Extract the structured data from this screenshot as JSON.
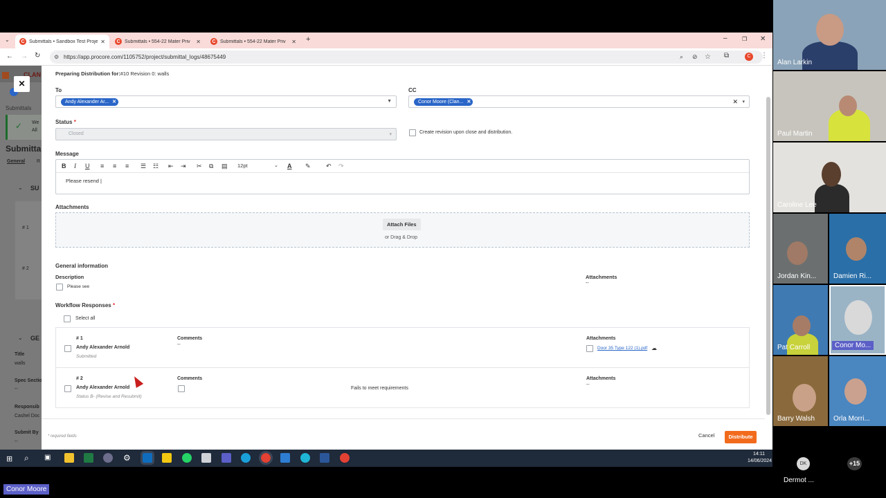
{
  "browser": {
    "tabs": [
      {
        "title": "Submittals • Sandbox Test Proje",
        "active": true
      },
      {
        "title": "Submittals • 554-22 Mater Priv",
        "active": false
      },
      {
        "title": "Submittals • 554-22 Mater Priv",
        "active": false
      }
    ],
    "url": "https://app.procore.com/1105752/project/submittal_logs/48675449",
    "profile_initial": "C"
  },
  "background_page": {
    "logo_partial": "CLAN",
    "breadcrumb": "Submittals",
    "page_title": "Submitta",
    "tabs": [
      "General",
      "R"
    ],
    "banner_line1": "We",
    "banner_line2": "All",
    "section1": "SU",
    "row1": "# 1",
    "row2": "# 2",
    "section2": "GE",
    "title_label": "Title",
    "title_value": "walls",
    "spec_label": "Spec Sectio",
    "spec_value": "--",
    "responsible_label": "Responsib",
    "responsible_value": "Cashel Doc",
    "submit_by_label": "Submit By",
    "submit_by_value": "--"
  },
  "modal": {
    "close_glyph": "✕",
    "heading_label": "Preparing Distribution for:",
    "heading_value": "#10 Revision 0: walls",
    "to_label": "To",
    "to_chip": "Andy Alexander Ar...",
    "cc_label": "CC",
    "cc_chip": "Conor Moore (Clan...",
    "status_label": "Status",
    "required_mark": "*",
    "status_value": "Closed",
    "create_revision_label": "Create revision upon close and distribution.",
    "message_label": "Message",
    "font_size": "12pt",
    "message_text": "Please resend",
    "attachments_label": "Attachments",
    "attach_files_button": "Attach Files",
    "drag_drop": "or Drag & Drop",
    "general_info_title": "General information",
    "description_label": "Description",
    "description_value": "Please see",
    "attachments_right_label": "Attachments",
    "attachments_right_value": "--",
    "workflow_title": "Workflow Responses",
    "select_all": "Select all",
    "responses": [
      {
        "number": "# 1",
        "name": "Andy Alexander Arnold",
        "status": "Submitted",
        "comments_label": "Comments",
        "comments_value": "--",
        "attachments_label": "Attachments",
        "attachment_file": "Door 35 Type 122 (1).pdf"
      },
      {
        "number": "# 2",
        "name": "Andy Alexander Arnold",
        "status": "Status B- (Revise and Resubmit)",
        "comments_label": "Comments",
        "comments_value": "Fails to meet requirements",
        "attachments_label": "Attachments",
        "attachments_value": "--"
      }
    ],
    "required_fields_note": "* required fields",
    "cancel_button": "Cancel",
    "distribute_button": "Distribute"
  },
  "taskbar": {
    "time": "14:11",
    "date": "14/06/2024"
  },
  "video_call": {
    "participants": [
      {
        "name": "Alan Larkin"
      },
      {
        "name": "Paul Martin"
      },
      {
        "name": "Caroline Lee"
      },
      {
        "name": "Jordan Kin..."
      },
      {
        "name": "Damien Ri..."
      },
      {
        "name": "Pat Carroll"
      },
      {
        "name": "Conor Mo..."
      },
      {
        "name": "Barry Walsh"
      },
      {
        "name": "Orla Morri..."
      }
    ],
    "extra_avatar_initials": "DK",
    "extra_avatar_name": "Dermot ...",
    "more_count": "+15",
    "presenter_label": "Conor Moore"
  },
  "colors": {
    "accent_orange": "#f26b1d",
    "chip_blue": "#2a66c8",
    "tab_bar": "#f9dbd9"
  }
}
